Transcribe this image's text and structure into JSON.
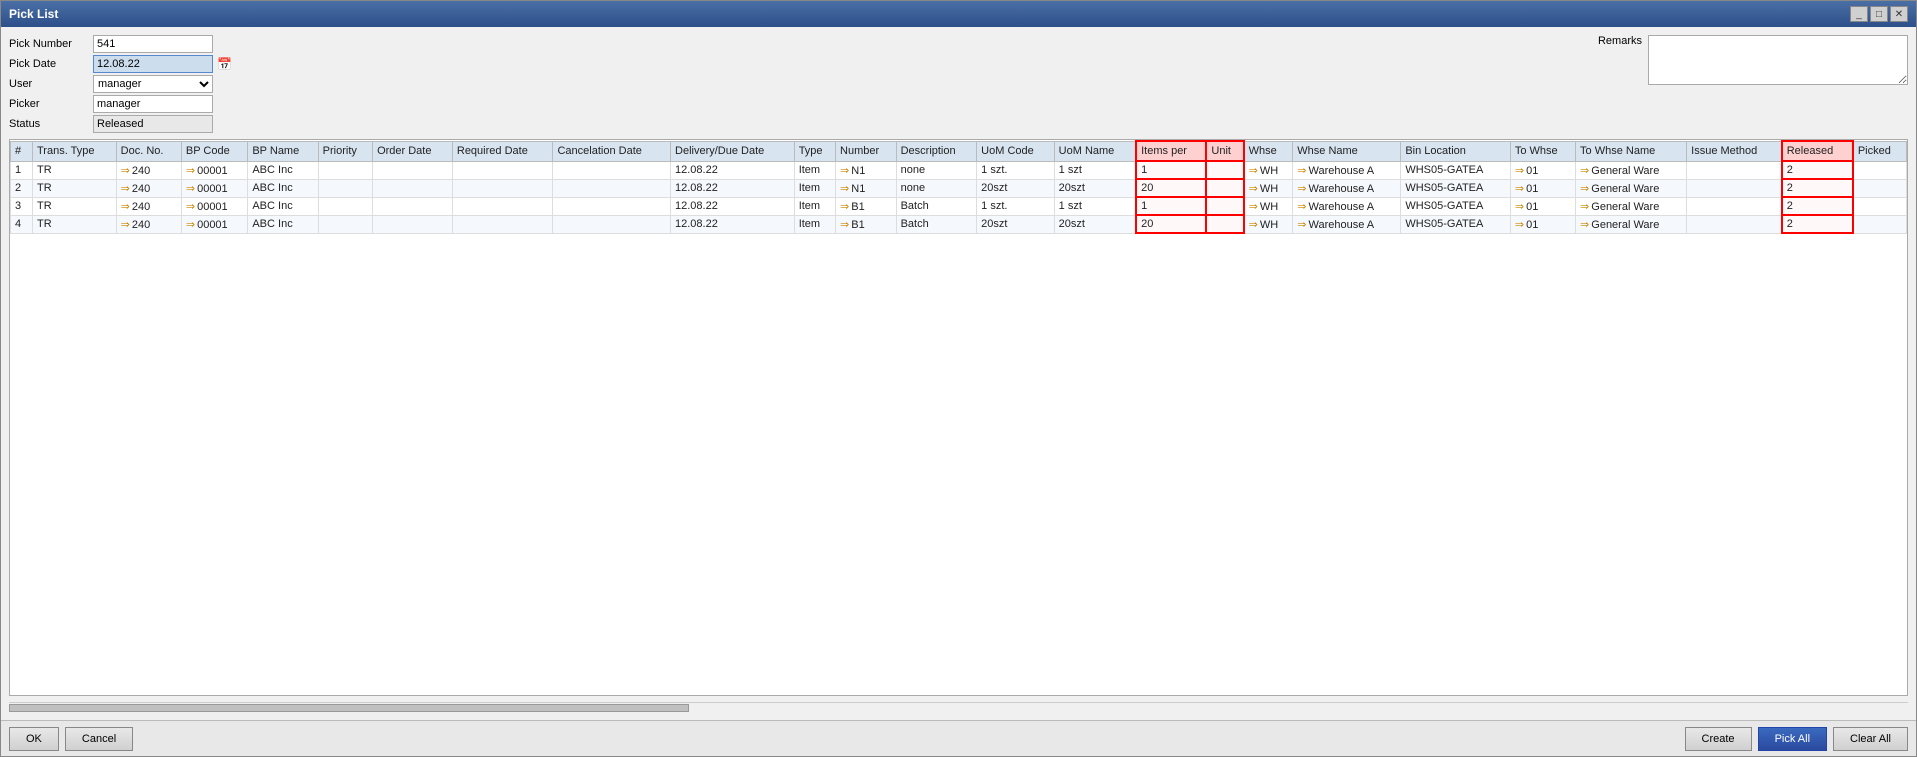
{
  "window": {
    "title": "Pick List",
    "controls": [
      "_",
      "□",
      "✕"
    ]
  },
  "form": {
    "pick_number_label": "Pick Number",
    "pick_number_value": "541",
    "pick_date_label": "Pick Date",
    "pick_date_value": "12.08.22",
    "user_label": "User",
    "user_value": "manager",
    "picker_label": "Picker",
    "picker_value": "manager",
    "status_label": "Status",
    "status_value": "Released",
    "remarks_label": "Remarks"
  },
  "table": {
    "columns": [
      "#",
      "Trans. Type",
      "Doc. No.",
      "BP Code",
      "BP Name",
      "Priority",
      "Order Date",
      "Required Date",
      "Cancelation Date",
      "Delivery/Due Date",
      "Type",
      "Number",
      "Description",
      "UoM Code",
      "UoM Name",
      "Items per",
      "Unit",
      "Whse",
      "Whse Name",
      "Bin Location",
      "To Whse",
      "To Whse Name",
      "Issue Method",
      "Released",
      "Picked"
    ],
    "rows": [
      {
        "num": "1",
        "trans_type": "TR",
        "doc_no": "240",
        "bp_code": "00001",
        "bp_name": "ABC Inc",
        "priority": "",
        "order_date": "",
        "required_date": "",
        "cancel_date": "",
        "delivery_date": "12.08.22",
        "type": "Item",
        "number": "N1",
        "description": "none",
        "uom_code": "1 szt.",
        "uom_name": "1 szt",
        "items_per": "1",
        "unit": "",
        "whse": "WH",
        "whse_name": "Warehouse A",
        "bin_location": "WHS05-GATEA",
        "to_whse": "01",
        "to_whse_name": "General Ware",
        "issue_method": "",
        "released": "2",
        "picked": ""
      },
      {
        "num": "2",
        "trans_type": "TR",
        "doc_no": "240",
        "bp_code": "00001",
        "bp_name": "ABC Inc",
        "priority": "",
        "order_date": "",
        "required_date": "",
        "cancel_date": "",
        "delivery_date": "12.08.22",
        "type": "Item",
        "number": "N1",
        "description": "none",
        "uom_code": "20szt",
        "uom_name": "20szt",
        "items_per": "20",
        "unit": "",
        "whse": "WH",
        "whse_name": "Warehouse A",
        "bin_location": "WHS05-GATEA",
        "to_whse": "01",
        "to_whse_name": "General Ware",
        "issue_method": "",
        "released": "2",
        "picked": ""
      },
      {
        "num": "3",
        "trans_type": "TR",
        "doc_no": "240",
        "bp_code": "00001",
        "bp_name": "ABC Inc",
        "priority": "",
        "order_date": "",
        "required_date": "",
        "cancel_date": "",
        "delivery_date": "12.08.22",
        "type": "Item",
        "number": "B1",
        "description": "Batch",
        "uom_code": "1 szt.",
        "uom_name": "1 szt",
        "items_per": "1",
        "unit": "",
        "whse": "WH",
        "whse_name": "Warehouse A",
        "bin_location": "WHS05-GATEA",
        "to_whse": "01",
        "to_whse_name": "General Ware",
        "issue_method": "",
        "released": "2",
        "picked": ""
      },
      {
        "num": "4",
        "trans_type": "TR",
        "doc_no": "240",
        "bp_code": "00001",
        "bp_name": "ABC Inc",
        "priority": "",
        "order_date": "",
        "required_date": "",
        "cancel_date": "",
        "delivery_date": "12.08.22",
        "type": "Item",
        "number": "B1",
        "description": "Batch",
        "uom_code": "20szt",
        "uom_name": "20szt",
        "items_per": "20",
        "unit": "",
        "whse": "WH",
        "whse_name": "Warehouse A",
        "bin_location": "WHS05-GATEA",
        "to_whse": "01",
        "to_whse_name": "General Ware",
        "issue_method": "",
        "released": "2",
        "picked": ""
      }
    ]
  },
  "footer": {
    "ok_label": "OK",
    "cancel_label": "Cancel",
    "create_label": "Create",
    "pick_all_label": "Pick All",
    "clear_all_label": "Clear All"
  }
}
